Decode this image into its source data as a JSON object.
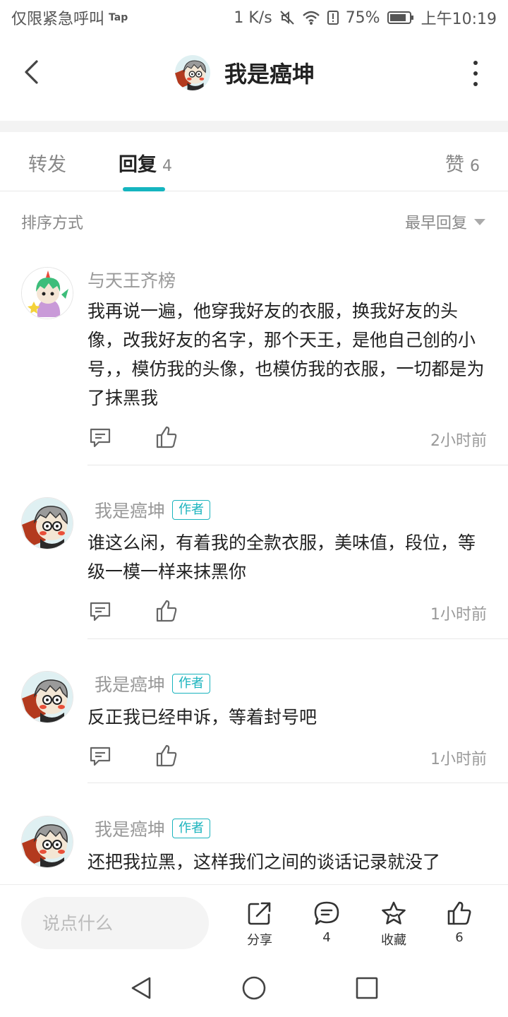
{
  "status_bar": {
    "carrier": "仅限紧急呼叫",
    "tap_label": "Tap",
    "speed": "1 K/s",
    "battery": "75%",
    "time": "上午10:19"
  },
  "header": {
    "title": "我是癌坤"
  },
  "tabs": {
    "forward": {
      "label": "转发"
    },
    "reply": {
      "label": "回复",
      "count": "4"
    },
    "like": {
      "label": "赞",
      "count": "6"
    }
  },
  "sort": {
    "label": "排序方式",
    "selected": "最早回复"
  },
  "comments": [
    {
      "user": "与天王齐榜",
      "is_author": false,
      "text": "我再说一遍，他穿我好友的衣服，换我好友的头像，改我好友的名字，那个天王，是他自己创的小号，，模仿我的头像，也模仿我的衣服，一切都是为了抹黑我",
      "time": "2小时前"
    },
    {
      "user": "我是癌坤",
      "is_author": true,
      "badge": "作者",
      "text": "谁这么闲，有着我的全款衣服，美味值，段位，等级一模一样来抹黑你",
      "time": "1小时前"
    },
    {
      "user": "我是癌坤",
      "is_author": true,
      "badge": "作者",
      "text": "反正我已经申诉，等着封号吧",
      "time": "1小时前"
    },
    {
      "user": "我是癌坤",
      "is_author": true,
      "badge": "作者",
      "text": "还把我拉黑，这样我们之间的谈话记录就没了"
    }
  ],
  "bottom_bar": {
    "input_placeholder": "说点什么",
    "share_label": "分享",
    "comment_count": "4",
    "collect_label": "收藏",
    "like_count": "6"
  },
  "colors": {
    "accent": "#15b5bf",
    "text_primary": "#222222",
    "text_secondary": "#999999"
  },
  "icons": [
    "back-arrow-icon",
    "more-vertical-icon",
    "reply-bubble-icon",
    "thumbs-up-icon",
    "share-icon",
    "comment-icon",
    "star-icon",
    "nav-back-icon",
    "nav-home-icon",
    "nav-recent-icon"
  ]
}
